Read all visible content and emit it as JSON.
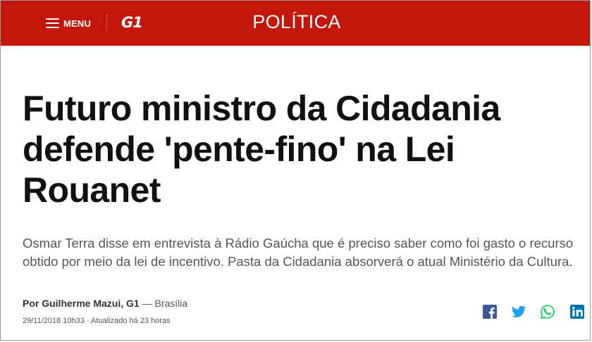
{
  "header": {
    "menu_label": "MENU",
    "logo_text": "G1",
    "section": "POLÍTICA",
    "background": "#c4170c"
  },
  "article": {
    "headline": "Futuro ministro da Cidadania defende 'pente-fino' na Lei Rouanet",
    "subtitle": "Osmar Terra disse em entrevista à Rádio Gaúcha que é preciso saber como foi gasto o recurso obtido por meio da lei de incentivo. Pasta da Cidadania absorverá o atual Ministério da Cultura.",
    "byline_author": "Por Guilherme Mazui, G1",
    "byline_location": " — Brasília",
    "date": "29/11/2018 10h33",
    "updated": " · Atualizado há 23 horas"
  },
  "share": {
    "icons": [
      "facebook-icon",
      "twitter-icon",
      "whatsapp-icon",
      "linkedin-icon"
    ],
    "colors": {
      "facebook": "#3b5998",
      "twitter": "#1da1f2",
      "whatsapp": "#25d366",
      "linkedin": "#0077b5"
    }
  }
}
